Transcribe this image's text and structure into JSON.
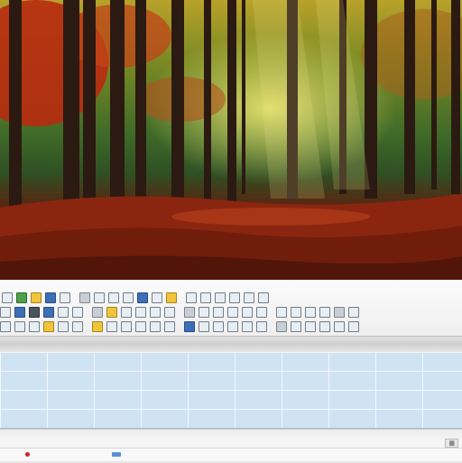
{
  "photo": {
    "subject": "autumn forest",
    "accent": "#b42a10"
  },
  "toolbar": {
    "row1": [
      "grid",
      "doc-edit",
      "star",
      "image",
      "notes",
      "image",
      "layers",
      "eye",
      "cursor",
      "table",
      "frame",
      "chart",
      "pages",
      "search",
      "brush",
      "shapes",
      "lasso",
      "curve"
    ],
    "row2": [
      "doc",
      "folder",
      "shield",
      "bolt",
      "list",
      "doc",
      "chart-bar",
      "image",
      "grid",
      "page",
      "text-t",
      "frame",
      "page",
      "cursor",
      "rotate",
      "color",
      "chart",
      "frame",
      "palette",
      "globe",
      "circle",
      "loop",
      "arrow",
      "grid"
    ],
    "row3": [
      "page",
      "pages",
      "film",
      "star",
      "image",
      "crop",
      "frame",
      "table",
      "image",
      "grid",
      "list",
      "chart",
      "pages",
      "frame",
      "circle",
      "lock",
      "grid",
      "page",
      "square",
      "frame",
      "grid",
      "list",
      "table",
      "image"
    ]
  },
  "colors": {
    "grid_bg": "#cfe3f3",
    "toolbar_bg": "#f2f2f2"
  }
}
